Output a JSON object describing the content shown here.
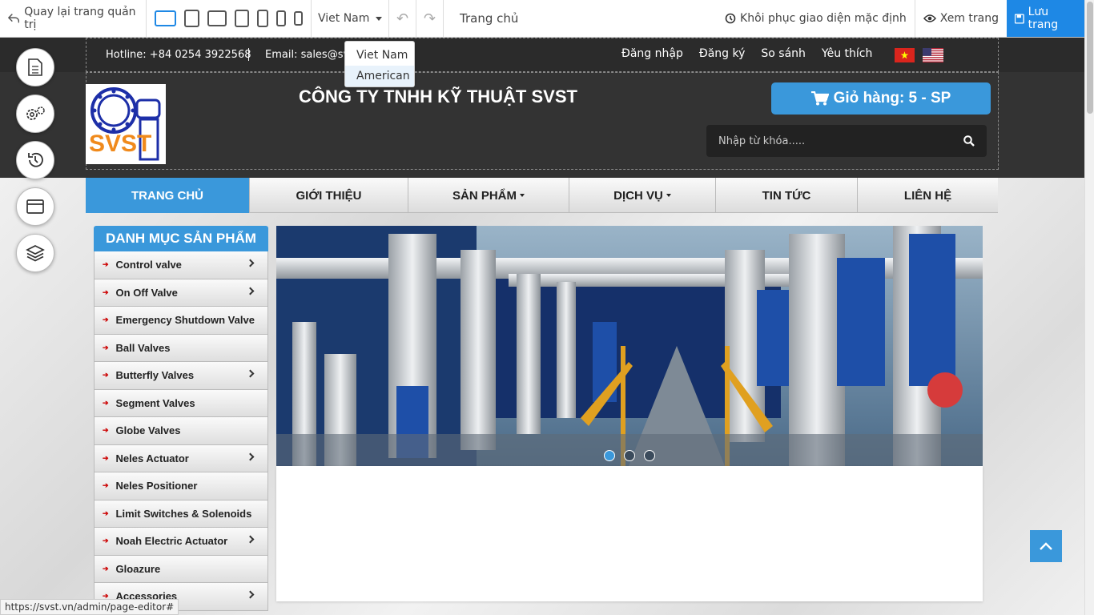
{
  "editor": {
    "back_label": "Quay lại trang quản trị",
    "language_selected": "Viet Nam",
    "language_options": [
      "Viet Nam",
      "American"
    ],
    "page_name": "Trang chủ",
    "restore_label": "Khôi phục giao diện mặc định",
    "preview_label": "Xem trang",
    "save_label": "Lưu trang"
  },
  "topbar": {
    "hotline": "Hotline: +84 0254 3922568",
    "email": "Email: sales@sv",
    "links": [
      "Đăng nhập",
      "Đăng ký",
      "So sánh",
      "Yêu thích"
    ]
  },
  "header": {
    "logo_text": "SVST",
    "company_name": "CÔNG TY TNHH KỸ THUẬT SVST",
    "cart_label": "Giỏ hàng: 5 - SP",
    "search_placeholder": "Nhập từ khóa....."
  },
  "nav": [
    "TRANG CHỦ",
    "GIỚI THIỆU",
    "SẢN PHẨM",
    "DỊCH VỤ",
    "TIN TỨC",
    "LIÊN HỆ"
  ],
  "category": {
    "title": "DANH MỤC SẢN PHẨM",
    "items": [
      "Control valve",
      "On Off Valve",
      "Emergency Shutdown Valve",
      "Ball Valves",
      "Butterfly Valves",
      "Segment Valves",
      "Globe Valves",
      "Neles Actuator",
      "Neles Positioner",
      "Limit Switches & Solenoids",
      "Noah Electric Actuator",
      "Gloazure",
      "Accessories"
    ]
  },
  "colors": {
    "accent": "#3a98db",
    "dark_header": "#333333",
    "save_blue": "#1e88e5"
  },
  "status_url": "https://svst.vn/admin/page-editor#"
}
